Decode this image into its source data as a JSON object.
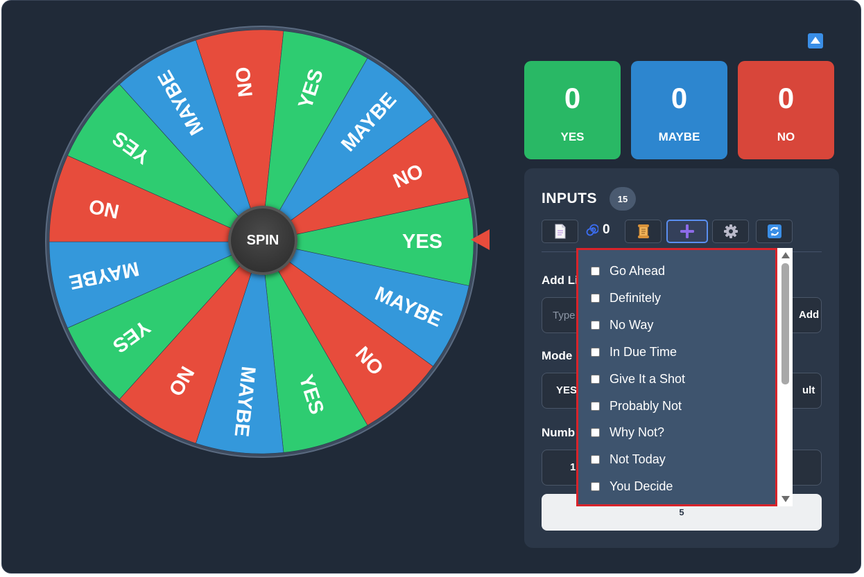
{
  "wheel": {
    "spin_label": "SPIN",
    "segments": [
      {
        "label": "YES",
        "color": "#2ecc71"
      },
      {
        "label": "MAYBE",
        "color": "#3498db"
      },
      {
        "label": "NO",
        "color": "#e74c3c"
      },
      {
        "label": "YES",
        "color": "#2ecc71"
      },
      {
        "label": "MAYBE",
        "color": "#3498db"
      },
      {
        "label": "NO",
        "color": "#e74c3c"
      },
      {
        "label": "YES",
        "color": "#2ecc71"
      },
      {
        "label": "MAYBE",
        "color": "#3498db"
      },
      {
        "label": "NO",
        "color": "#e74c3c"
      },
      {
        "label": "YES",
        "color": "#2ecc71"
      },
      {
        "label": "MAYBE",
        "color": "#3498db"
      },
      {
        "label": "NO",
        "color": "#e74c3c"
      },
      {
        "label": "YES",
        "color": "#2ecc71"
      },
      {
        "label": "MAYBE",
        "color": "#3498db"
      },
      {
        "label": "NO",
        "color": "#e74c3c"
      }
    ]
  },
  "counters": {
    "yes": {
      "value": "0",
      "label": "YES",
      "color": "#29b865"
    },
    "maybe": {
      "value": "0",
      "label": "MAYBE",
      "color": "#2d86cf"
    },
    "no": {
      "value": "0",
      "label": "NO",
      "color": "#d8463a"
    }
  },
  "inputs": {
    "title": "INPUTS",
    "count": "15",
    "spin_count": "0",
    "add_list_label": "Add Li",
    "input_placeholder": "Type",
    "add_button": "Add",
    "mode_label": "Mode",
    "mode_value": "YES",
    "mode_right": "ult",
    "number_label": "Numb",
    "number_left": "1",
    "number_button": "5"
  },
  "dropdown": {
    "options": [
      "Go Ahead",
      "Definitely",
      "No Way",
      "In Due Time",
      "Give It a Shot",
      "Probably Not",
      "Why Not?",
      "Not Today",
      "You Decide"
    ]
  },
  "icons": {
    "collapse": "caret-up-icon",
    "document": "document-icon",
    "spiral": "spiral-icon",
    "scroll": "scroll-icon",
    "plus": "plus-icon",
    "gear": "gear-icon",
    "refresh": "refresh-icon"
  }
}
